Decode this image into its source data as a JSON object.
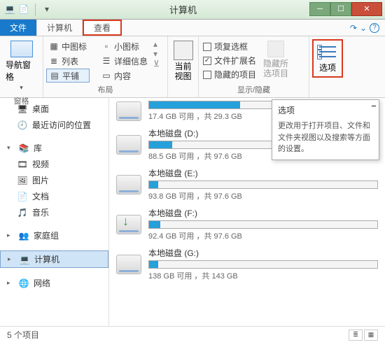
{
  "window": {
    "title": "计算机"
  },
  "tabs": {
    "file": "文件",
    "computer": "计算机",
    "view": "查看"
  },
  "ribbon": {
    "panes": {
      "nav": "导航窗格",
      "group": "窗格"
    },
    "layout": {
      "medium_icons": "中图标",
      "small_icons": "小图标",
      "list": "列表",
      "details": "详细信息",
      "tiles": "平铺",
      "content": "内容",
      "group": "布局"
    },
    "current_view": {
      "btn": "当前\n视图"
    },
    "showhide": {
      "checkboxes": "项复选框",
      "extensions": "文件扩展名",
      "hidden_items": "隐藏的项目",
      "hide_selected": "隐藏所\n选项目",
      "group": "显示/隐藏"
    },
    "options": "选项"
  },
  "sidebar": {
    "desktop": "桌面",
    "recent": "最近访问的位置",
    "libraries": "库",
    "videos": "视频",
    "pictures": "图片",
    "documents": "文档",
    "music": "音乐",
    "homegroup": "家庭组",
    "computer": "计算机",
    "network": "网络"
  },
  "tooltip": {
    "title": "选项",
    "body": "更改用于打开项目、文件和文件夹视图以及搜索等方面的设置。"
  },
  "drives": [
    {
      "name": "",
      "free": "17.4 GB 可用 ，共 29.3 GB",
      "pct": 40
    },
    {
      "name": "本地磁盘 (D:)",
      "free": "88.5 GB 可用 ，共 97.6 GB",
      "pct": 10
    },
    {
      "name": "本地磁盘 (E:)",
      "free": "93.8 GB 可用 ，共 97.6 GB",
      "pct": 4
    },
    {
      "name": "本地磁盘 (F:)",
      "free": "92.4 GB 可用 ，共 97.6 GB",
      "pct": 5
    },
    {
      "name": "本地磁盘 (G:)",
      "free": "138 GB 可用 ，共 143 GB",
      "pct": 4
    }
  ],
  "status": {
    "count": "5 个项目"
  }
}
